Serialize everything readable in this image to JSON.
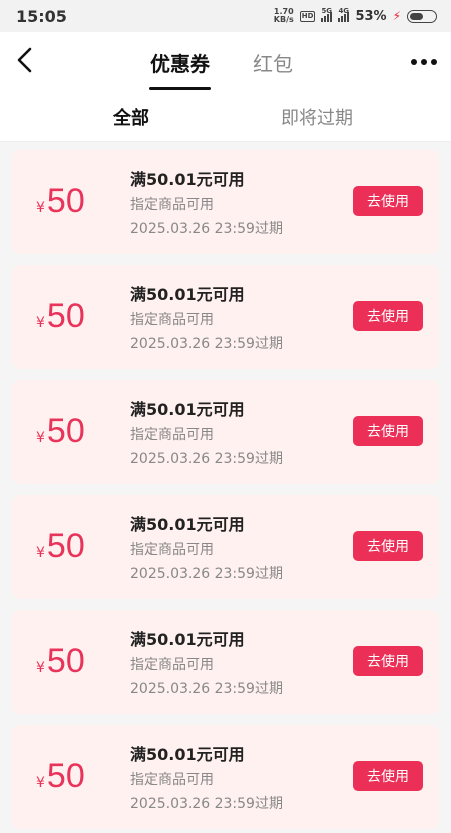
{
  "status_bar": {
    "time": "15:05",
    "net_speed_value": "1.70",
    "net_speed_unit": "KB/s",
    "hd_label": "HD",
    "sim1_label": "5G",
    "sim2_label": "4G",
    "battery": "53%"
  },
  "header": {
    "tabs": [
      {
        "label": "优惠券",
        "active": true
      },
      {
        "label": "红包",
        "active": false
      }
    ]
  },
  "subtabs": [
    {
      "label": "全部",
      "active": true
    },
    {
      "label": "即将过期",
      "active": false
    }
  ],
  "coupons": [
    {
      "currency": "¥",
      "amount": "50",
      "condition": "满50.01元可用",
      "scope": "指定商品可用",
      "expire": "2025.03.26 23:59过期",
      "button": "去使用"
    },
    {
      "currency": "¥",
      "amount": "50",
      "condition": "满50.01元可用",
      "scope": "指定商品可用",
      "expire": "2025.03.26 23:59过期",
      "button": "去使用"
    },
    {
      "currency": "¥",
      "amount": "50",
      "condition": "满50.01元可用",
      "scope": "指定商品可用",
      "expire": "2025.03.26 23:59过期",
      "button": "去使用"
    },
    {
      "currency": "¥",
      "amount": "50",
      "condition": "满50.01元可用",
      "scope": "指定商品可用",
      "expire": "2025.03.26 23:59过期",
      "button": "去使用"
    },
    {
      "currency": "¥",
      "amount": "50",
      "condition": "满50.01元可用",
      "scope": "指定商品可用",
      "expire": "2025.03.26 23:59过期",
      "button": "去使用"
    },
    {
      "currency": "¥",
      "amount": "50",
      "condition": "满50.01元可用",
      "scope": "指定商品可用",
      "expire": "2025.03.26 23:59过期",
      "button": "去使用"
    }
  ],
  "colors": {
    "accent": "#ec2f57",
    "amount": "#e8335a",
    "card_bg": "#fff1ef"
  },
  "icons": {
    "back": "chevron-left-icon",
    "more": "more-horizontal-icon"
  }
}
